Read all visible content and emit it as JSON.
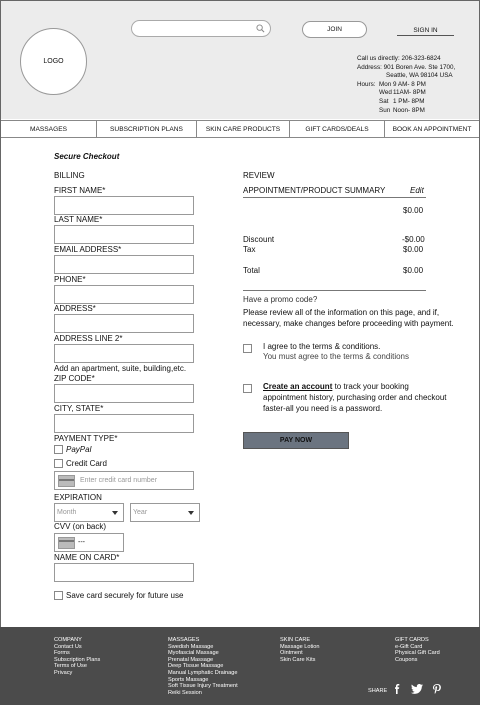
{
  "header": {
    "logo": "LOGO",
    "join_label": "JOIN",
    "signin_label": "SIGN IN",
    "contact": {
      "phone": "Call us directly: 206-323-6824",
      "address1": "Address: 901 Boren Ave. Ste 1700,",
      "address2": "Seattle, WA 98104 USA",
      "hours_label": "Hours:",
      "hours": [
        {
          "day": "Mon",
          "time": "9 AM- 8 PM"
        },
        {
          "day": "Wed",
          "time": "11AM- 8PM"
        },
        {
          "day": "Sat",
          "time": "1 PM- 8PM"
        },
        {
          "day": "Sun",
          "time": "Noon- 8PM"
        }
      ]
    }
  },
  "nav": [
    {
      "label": "MASSAGES"
    },
    {
      "label": "SUBSCRIPTION PLANS"
    },
    {
      "label": "SKIN CARE PRODUCTS"
    },
    {
      "label": "GIFT CARDS/DEALS"
    },
    {
      "label": "BOOK AN APPOINTMENT"
    }
  ],
  "checkout": {
    "title": "Secure Checkout",
    "billing_heading": "BILLING",
    "first_name": "FIRST NAME*",
    "last_name": "LAST NAME*",
    "email": "EMAIL ADDRESS*",
    "phone": "PHONE*",
    "address": "ADDRESS*",
    "address2": "ADDRESS LINE 2*",
    "address2_hint": "Add an apartment, suite, building,etc.",
    "zip": "ZIP CODE*",
    "city_state": "CITY, STATE*",
    "payment_type": "PAYMENT TYPE*",
    "paypal": "PayPal",
    "credit_card": "Credit Card",
    "card_placeholder": "Enter credit card number",
    "expiration": "EXPIRATION",
    "month_placeholder": "Month",
    "year_placeholder": "Year",
    "cvv": "CVV (on back)",
    "cvv_mask": "---",
    "name_on_card": "NAME ON CARD*",
    "save_card": "Save card securely for future use"
  },
  "review": {
    "heading": "REVIEW",
    "summary_label": "APPOINTMENT/PRODUCT SUMMARY",
    "edit_label": "Edit",
    "subtotal": "$0.00",
    "discount_label": "Discount",
    "discount_value": "-$0.00",
    "tax_label": "Tax",
    "tax_value": "$0.00",
    "total_label": "Total",
    "total_value": "$0.00",
    "promo": "Have a promo code?",
    "notice1": "Please review all of the information on this page, and if,",
    "notice2": "necessary, make changes before proceeding with payment.",
    "terms1": "I agree to the terms & conditions.",
    "terms2": "You must agree to the terms & conditions",
    "account_link": "Create an account",
    "account1": " to track your booking",
    "account2": "appointment history, purchasing order and checkout",
    "account3": "faster-all you need is a password.",
    "pay_label": "PAY NOW"
  },
  "footer": {
    "company": {
      "heading": "COMPANY",
      "items": [
        "Contact Us",
        "Forms",
        "Subscription Plans",
        "Terms of Use",
        "Privacy"
      ]
    },
    "massages": {
      "heading": "MASSAGES",
      "items": [
        "Swedish Massage",
        "Myofascial Massage",
        "Prenatal Massage",
        "Deep Tissue Massage",
        "Manual Lymphatic Drainage",
        "Sports Massage",
        "Soft Tissue Injury Treatment",
        "Reiki Session"
      ]
    },
    "skincare": {
      "heading": "SKIN CARE",
      "items": [
        "Massage Lotion",
        "Ointment",
        "Skin Care Kits"
      ]
    },
    "giftcards": {
      "heading": "GIFT CARDS",
      "items": [
        "e-Gift Card",
        "Physical Gift Card",
        "Coupons"
      ]
    },
    "share_label": "SHARE"
  },
  "colors": {
    "header_bg": "#ececec",
    "footer_bg": "#4b4b4b",
    "pay_button": "#6b7480"
  }
}
